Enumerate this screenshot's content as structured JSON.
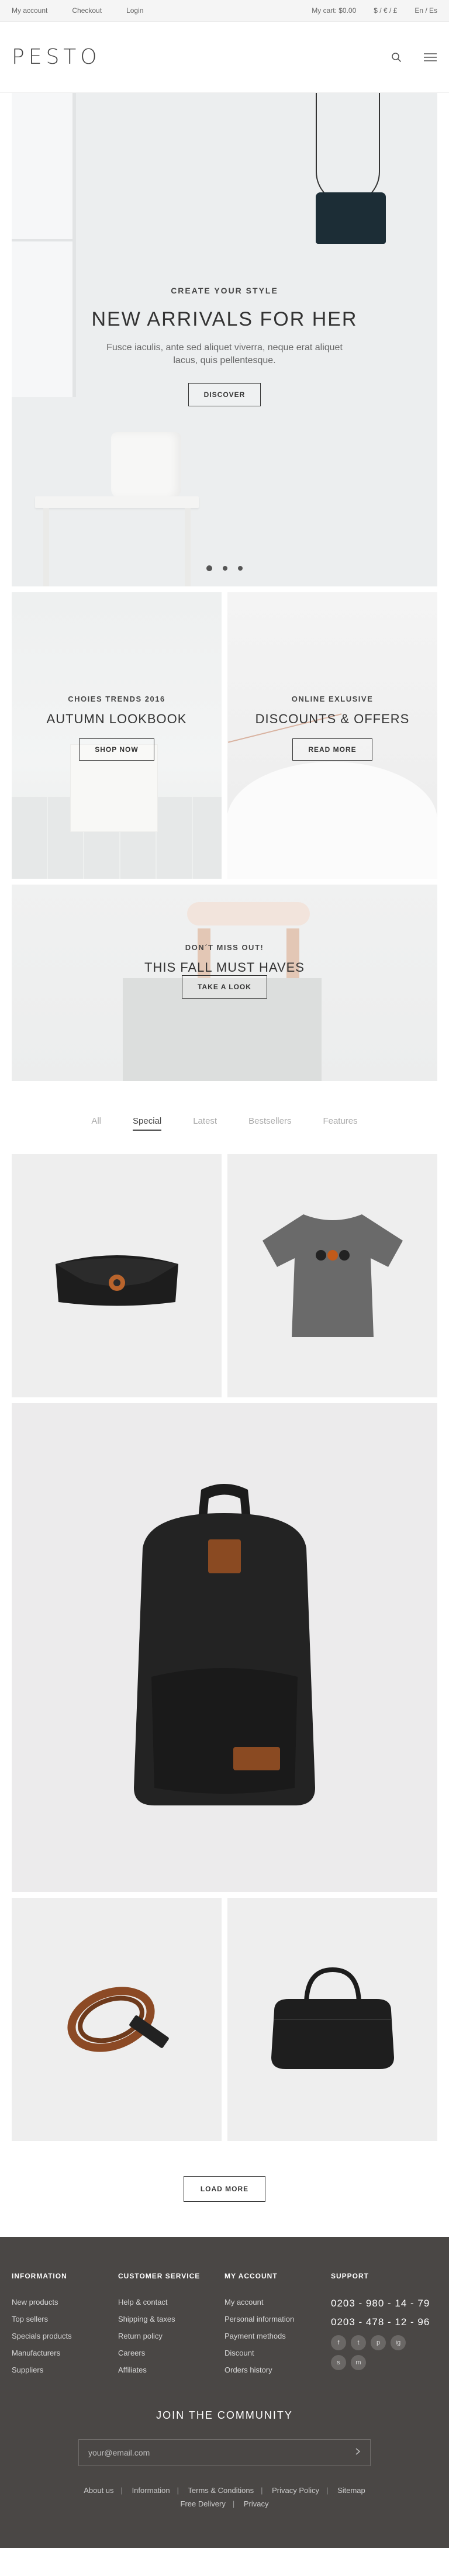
{
  "topbar": {
    "my_account": "My account",
    "checkout": "Checkout",
    "login": "Login",
    "cart": "My cart: $0.00",
    "currency": "$ / € / £",
    "language": "En / Es"
  },
  "header": {
    "logo": "PESTO"
  },
  "hero": {
    "kicker": "CREATE YOUR STYLE",
    "title": "NEW ARRIVALS FOR HER",
    "description": "Fusce iaculis, ante sed aliquet viverra, neque erat aliquet lacus, quis pellentesque.",
    "button": "DISCOVER",
    "active_slide": 1,
    "slides": 3
  },
  "promos": {
    "left": {
      "kicker": "CHOIES TRENDS 2016",
      "title": "AUTUMN LOOKBOOK",
      "button": "SHOP NOW"
    },
    "right": {
      "kicker": "ONLINE EXLUSIVE",
      "title": "DISCOUNTS & OFFERS",
      "button": "READ MORE"
    },
    "wide": {
      "kicker": "DON´T MISS OUT!",
      "title": "THIS FALL MUST HAVES",
      "button": "TAKE A LOOK"
    }
  },
  "tabs": [
    "All",
    "Special",
    "Latest",
    "Bestsellers",
    "Features"
  ],
  "active_tab": "Special",
  "products": {
    "p1": "clutch-bag",
    "p2": "grey-tshirt",
    "p3": "black-backpack",
    "p4": "leather-bracelet",
    "p5": "black-handbag"
  },
  "load_more": "LOAD MORE",
  "footer": {
    "information": {
      "title": "INFORMATION",
      "items": [
        "New products",
        "Top sellers",
        "Specials products",
        "Manufacturers",
        "Suppliers"
      ]
    },
    "customer_service": {
      "title": "CUSTOMER SERVICE",
      "items": [
        "Help & contact",
        "Shipping & taxes",
        "Return policy",
        "Careers",
        "Affiliates"
      ]
    },
    "my_account": {
      "title": "MY ACCOUNT",
      "items": [
        "My account",
        "Personal information",
        "Payment methods",
        "Discount",
        "Orders history"
      ]
    },
    "support": {
      "title": "SUPPORT",
      "phone1": "0203 - 980 - 14 - 79",
      "phone2": "0203 - 478 - 12 - 96",
      "socials": [
        "f",
        "t",
        "p",
        "ig",
        "s",
        "m"
      ]
    },
    "community_title": "JOIN THE COMMUNITY",
    "email_placeholder": "your@email.com",
    "links": [
      "About us",
      "Information",
      "Terms & Conditions",
      "Privacy Policy",
      "Sitemap",
      "Free Delivery",
      "Privacy"
    ]
  }
}
